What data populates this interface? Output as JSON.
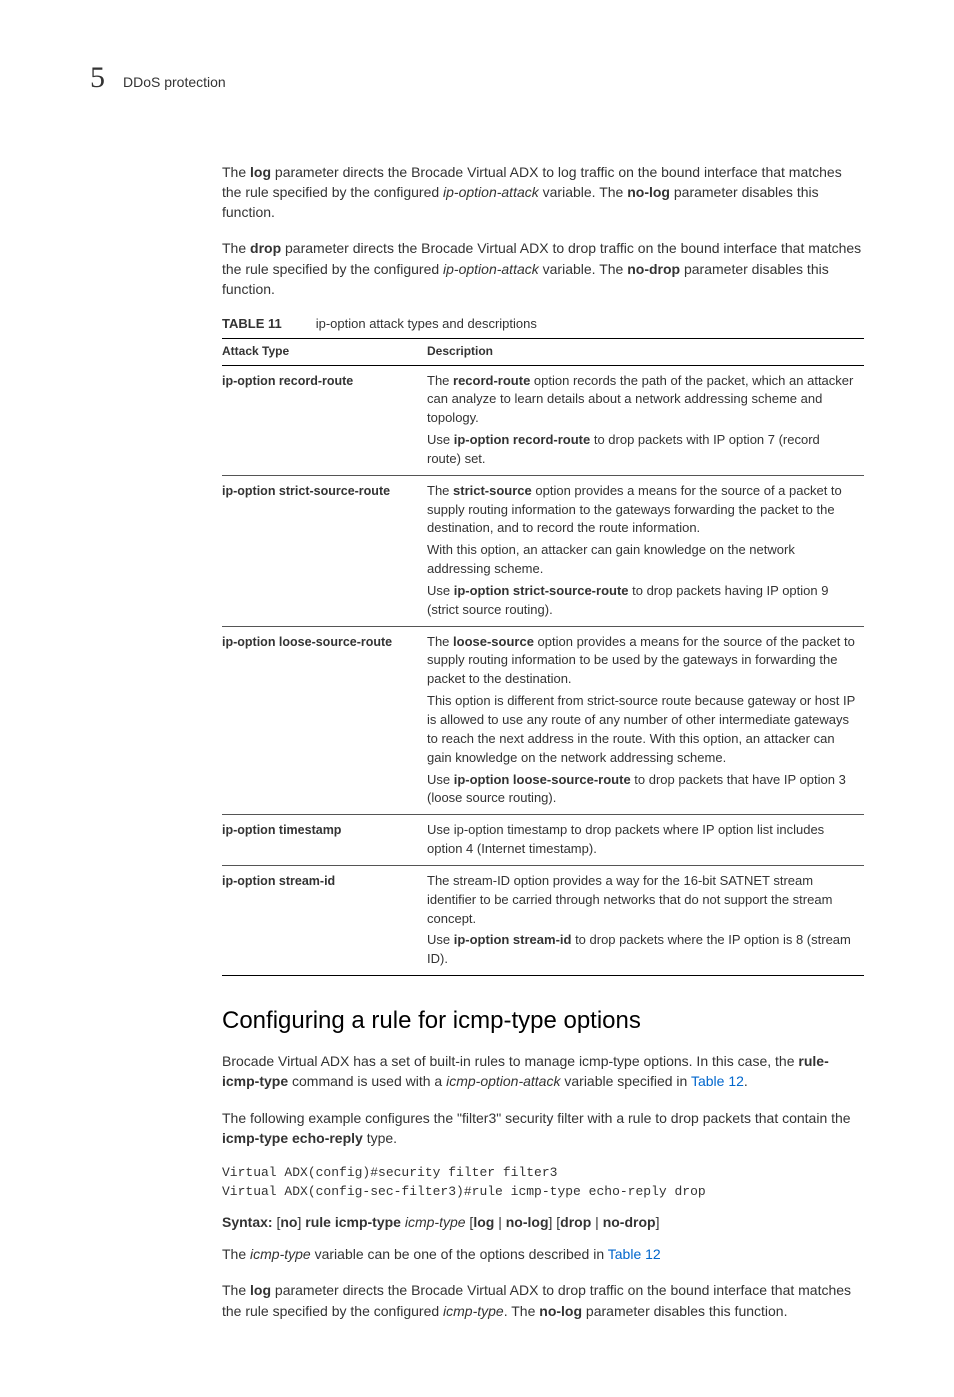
{
  "header": {
    "chapter_number": "5",
    "chapter_title": "DDoS protection"
  },
  "intro": {
    "p1_a": "The ",
    "p1_b": "log",
    "p1_c": " parameter directs the Brocade Virtual ADX to log traffic on the bound interface that matches the rule specified by the configured ",
    "p1_d": "ip-option-attack",
    "p1_e": " variable. The ",
    "p1_f": "no-log",
    "p1_g": " parameter disables this function.",
    "p2_a": "The ",
    "p2_b": "drop",
    "p2_c": " parameter directs the Brocade Virtual ADX to drop traffic on the bound interface that matches the rule specified by the configured ",
    "p2_d": "ip-option-attack",
    "p2_e": " variable. The ",
    "p2_f": "no-drop",
    "p2_g": " parameter disables this function."
  },
  "table11": {
    "label": "TABLE 11",
    "caption": "ip-option attack types and descriptions",
    "col1": "Attack Type",
    "col2": "Description",
    "rows": [
      {
        "type": "ip-option record-route",
        "d1a": "The ",
        "d1b": "record-route",
        "d1c": " option records the path of the packet, which an attacker can analyze to learn details about a network addressing scheme and topology.",
        "d2a": "Use ",
        "d2b": "ip-option record-route",
        "d2c": " to drop packets with IP option 7 (record route) set."
      },
      {
        "type": "ip-option strict-source-route",
        "d1a": "The ",
        "d1b": "strict-source",
        "d1c": " option provides a means for the source of a packet to supply routing information to the gateways forwarding the packet to the destination, and to record the route information.",
        "d2": "With this option, an attacker can gain knowledge on the network addressing scheme.",
        "d3a": "Use ",
        "d3b": "ip-option strict-source-route",
        "d3c": " to drop packets having IP option 9 (strict source routing)."
      },
      {
        "type": "ip-option loose-source-route",
        "d1a": "The ",
        "d1b": "loose-source",
        "d1c": " option provides a means for the source of the packet to supply routing information to be used by the gateways in forwarding the packet to the destination.",
        "d2": "This option is different from strict-source route because gateway or host IP is allowed to use any route of any number of other intermediate gateways to reach the next address in the route. With this option, an attacker can gain knowledge on the network addressing scheme.",
        "d3a": "Use ",
        "d3b": "ip-option loose-source-route",
        "d3c": " to drop packets that have IP option 3 (loose source routing)."
      },
      {
        "type": "ip-option timestamp",
        "d1": "Use ip-option timestamp to drop packets where IP option list includes option 4 (Internet timestamp)."
      },
      {
        "type": "ip-option stream-id",
        "d1": "The stream-ID option provides a way for the 16-bit SATNET stream identifier to be carried through networks that do not support the stream concept.",
        "d2a": "Use ",
        "d2b": "ip-option stream-id",
        "d2c": " to drop packets where the IP option is 8 (stream ID)."
      }
    ]
  },
  "section2": {
    "heading": "Configuring a rule for icmp-type options",
    "p1a": "Brocade Virtual ADX has a set of built-in rules to manage icmp-type options. In this case, the ",
    "p1b": "rule-icmp-type",
    "p1c": " command is used with a ",
    "p1d": "icmp-option-attack",
    "p1e": " variable specified in ",
    "p1f": "Table 12",
    "p1g": ".",
    "p2a": "The following example configures the \"filter3\" security filter with a rule to drop packets that contain the ",
    "p2b": "icmp-type echo-reply",
    "p2c": " type.",
    "code": "Virtual ADX(config)#security filter filter3\nVirtual ADX(config-sec-filter3)#rule icmp-type echo-reply drop",
    "syntax_label": "Syntax:",
    "syntax_a": " [",
    "syntax_b": "no",
    "syntax_c": "] ",
    "syntax_d": "rule icmp-type",
    "syntax_e": " icmp-type ",
    "syntax_f": "[",
    "syntax_g": "log",
    "syntax_h": " | ",
    "syntax_i": "no-log",
    "syntax_j": "] [",
    "syntax_k": "drop",
    "syntax_l": " | ",
    "syntax_m": "no-drop",
    "syntax_n": "]",
    "p3a": "The ",
    "p3b": "icmp-type",
    "p3c": " variable can be one of the options described in ",
    "p3d": "Table 12",
    "p4a": "The ",
    "p4b": "log",
    "p4c": " parameter directs the Brocade Virtual ADX to drop traffic on the bound interface that matches the rule specified by the configured ",
    "p4d": "icmp-type",
    "p4e": ". The ",
    "p4f": "no-log",
    "p4g": " parameter disables this function."
  }
}
